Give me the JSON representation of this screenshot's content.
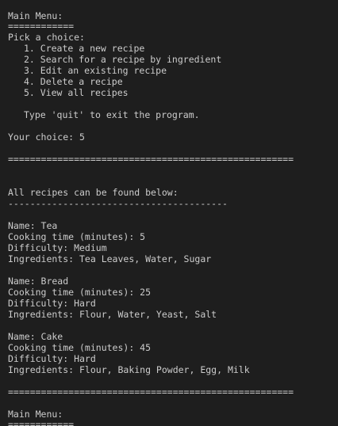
{
  "terminal": {
    "menu_title": "Main Menu:",
    "menu_underline": "============",
    "prompt": "Pick a choice:",
    "options": [
      "1. Create a new recipe",
      "2. Search for a recipe by ingredient",
      "3. Edit an existing recipe",
      "4. Delete a recipe",
      "5. View all recipes"
    ],
    "quit_hint": "Type 'quit' to exit the program.",
    "choice_line": "Your choice: 5",
    "separator": "====================================================",
    "recipes_header": "All recipes can be found below:",
    "recipes_underline": "----------------------------------------",
    "recipes": [
      {
        "name": "Name: Tea",
        "cooking_time": "Cooking time (minutes): 5",
        "difficulty": "Difficulty: Medium",
        "ingredients": "Ingredients: Tea Leaves, Water, Sugar"
      },
      {
        "name": "Name: Bread",
        "cooking_time": "Cooking time (minutes): 25",
        "difficulty": "Difficulty: Hard",
        "ingredients": "Ingredients: Flour, Water, Yeast, Salt"
      },
      {
        "name": "Name: Cake",
        "cooking_time": "Cooking time (minutes): 45",
        "difficulty": "Difficulty: Hard",
        "ingredients": "Ingredients: Flour, Baking Powder, Egg, Milk"
      }
    ],
    "menu_title_2": "Main Menu:",
    "menu_underline_2": "============"
  },
  "colors": {
    "background": "#1e1e1e",
    "text": "#cccccc"
  }
}
